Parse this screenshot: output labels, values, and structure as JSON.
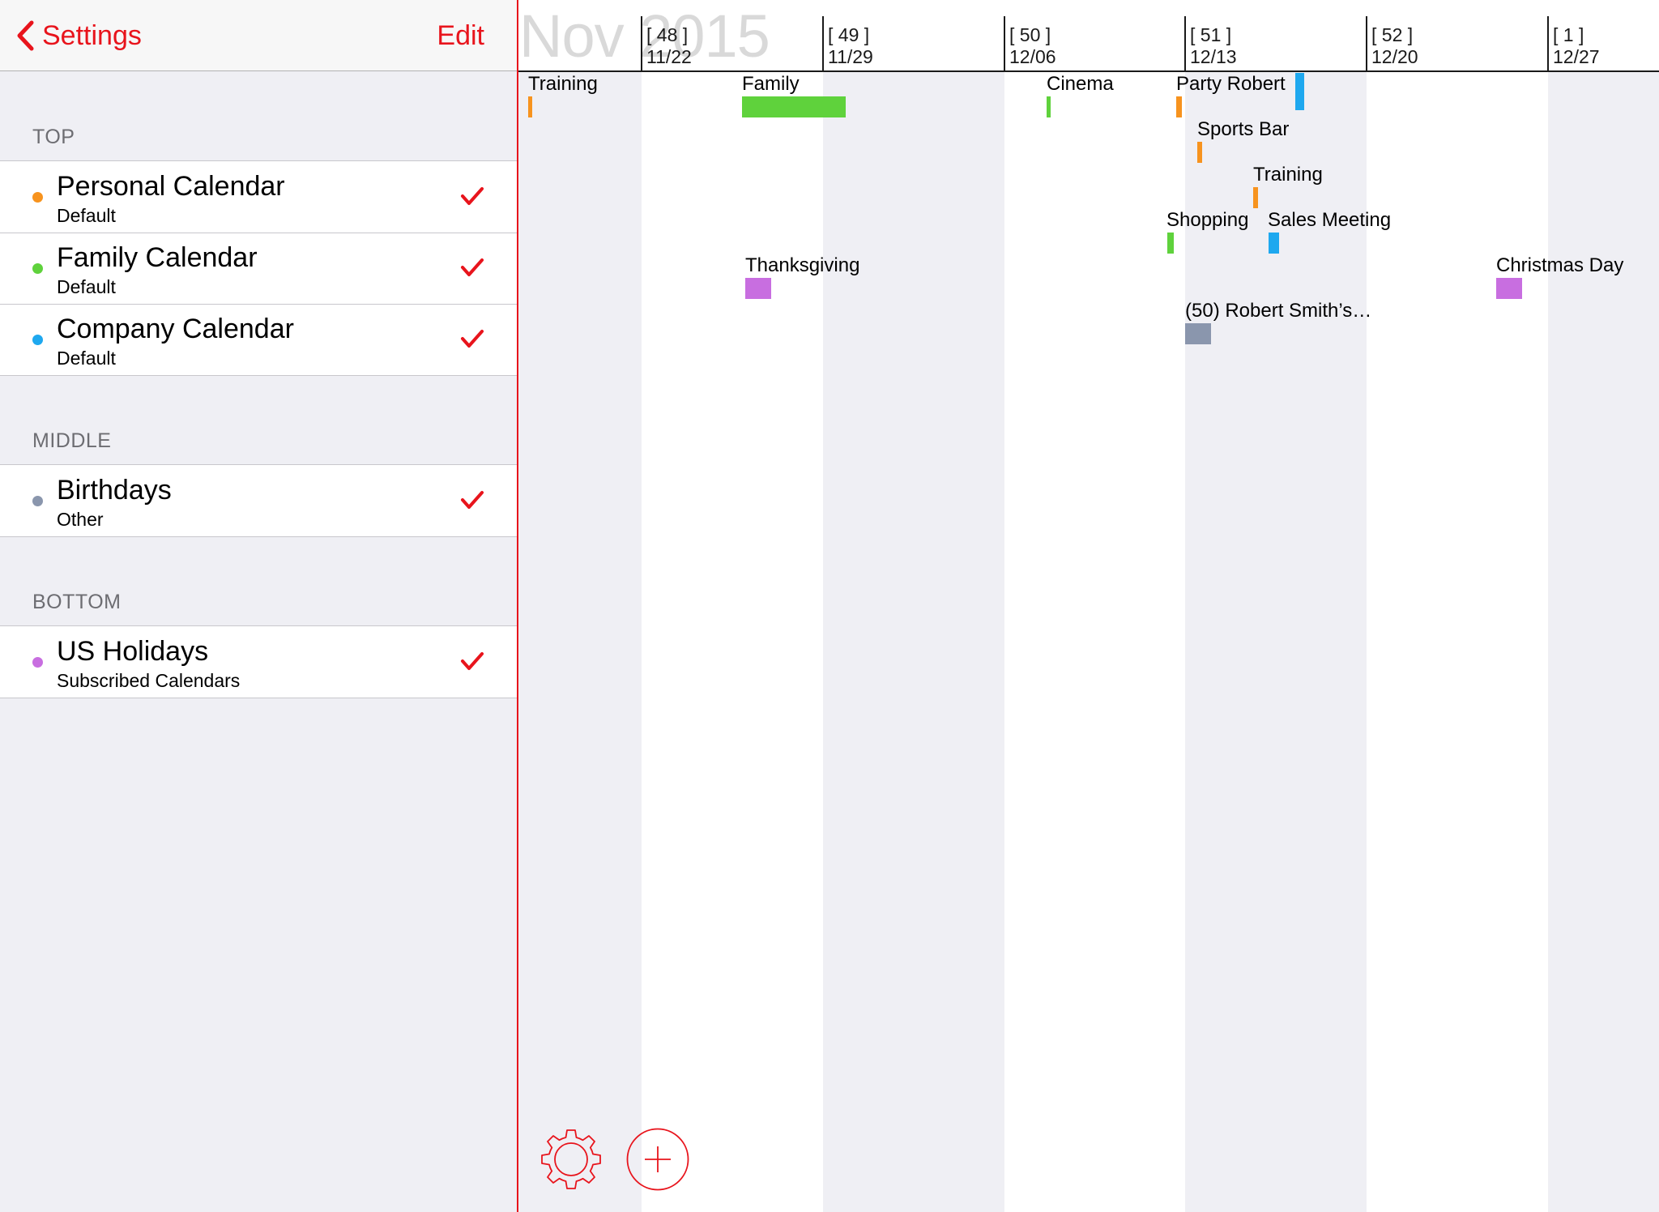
{
  "navbar": {
    "back_label": "Settings",
    "edit_label": "Edit"
  },
  "sections": [
    {
      "header": "TOP",
      "items": [
        {
          "title": "Personal Calendar",
          "subtitle": "Default",
          "color": "#f7931e",
          "checked": true
        },
        {
          "title": "Family Calendar",
          "subtitle": "Default",
          "color": "#5fd23c",
          "checked": true
        },
        {
          "title": "Company Calendar",
          "subtitle": "Default",
          "color": "#1ea8ef",
          "checked": true
        }
      ]
    },
    {
      "header": "MIDDLE",
      "items": [
        {
          "title": "Birthdays",
          "subtitle": "Other",
          "color": "#8a96ad",
          "checked": true
        }
      ]
    },
    {
      "header": "BOTTOM",
      "items": [
        {
          "title": "US Holidays",
          "subtitle": "Subscribed Calendars",
          "color": "#c86ee0",
          "checked": true
        }
      ]
    }
  ],
  "accent_color": "#e8141c",
  "timeline": {
    "month_label": "Nov 2015",
    "weeks": [
      {
        "number": "[ 48 ]",
        "date": "11/22"
      },
      {
        "number": "[ 49 ]",
        "date": "11/29"
      },
      {
        "number": "[ 50 ]",
        "date": "12/06"
      },
      {
        "number": "[ 51 ]",
        "date": "12/13"
      },
      {
        "number": "[ 52 ]",
        "date": "12/20"
      },
      {
        "number": "[ 1 ]",
        "date": "12/27"
      }
    ],
    "events": [
      {
        "label": "Training",
        "calendar": "Personal Calendar",
        "color": "#f7931e"
      },
      {
        "label": "Family",
        "calendar": "Family Calendar",
        "color": "#5fd23c"
      },
      {
        "label": "Cinema",
        "calendar": "Family Calendar",
        "color": "#5fd23c"
      },
      {
        "label": "Party Robert",
        "calendar": "Personal Calendar",
        "color": "#f7931e"
      },
      {
        "label": "",
        "calendar": "Company Calendar",
        "color": "#1ea8ef"
      },
      {
        "label": "Sports Bar",
        "calendar": "Personal Calendar",
        "color": "#f7931e"
      },
      {
        "label": "Training",
        "calendar": "Personal Calendar",
        "color": "#f7931e"
      },
      {
        "label": "Shopping",
        "calendar": "Family Calendar",
        "color": "#5fd23c"
      },
      {
        "label": "Sales Meeting",
        "calendar": "Company Calendar",
        "color": "#1ea8ef"
      },
      {
        "label": "Thanksgiving",
        "calendar": "US Holidays",
        "color": "#c86ee0"
      },
      {
        "label": "Christmas Day",
        "calendar": "US Holidays",
        "color": "#c86ee0"
      },
      {
        "label": "(50) Robert Smith’s…",
        "calendar": "Birthdays",
        "color": "#8a96ad"
      }
    ]
  },
  "toolbar": {
    "settings_icon": "gear-icon",
    "add_icon": "plus-circle-icon"
  }
}
